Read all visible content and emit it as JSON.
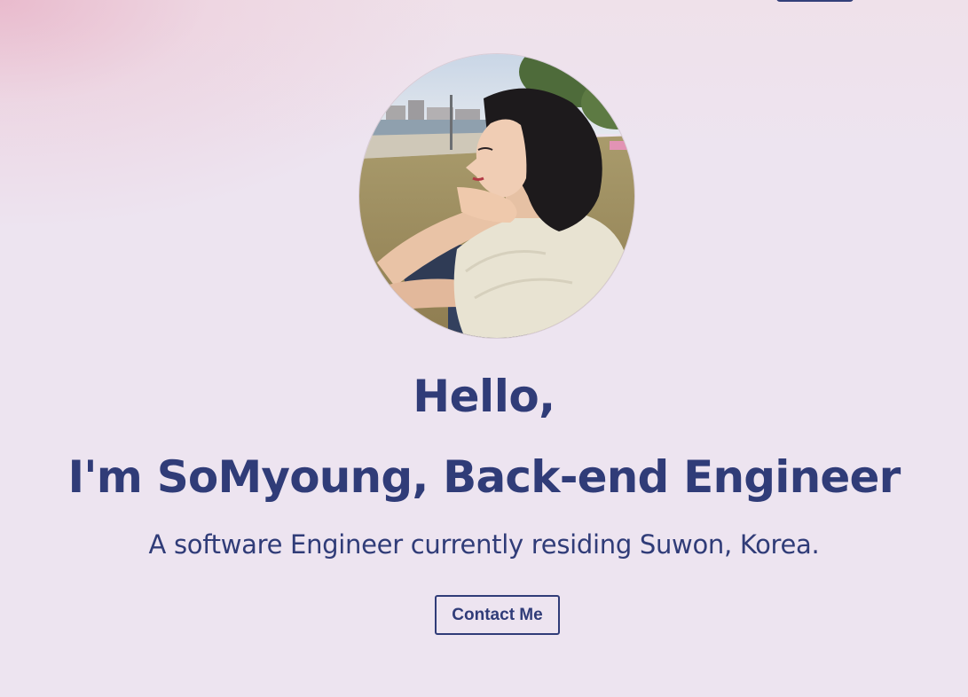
{
  "hero": {
    "greeting": "Hello,",
    "headline": "I'm SoMyoung, Back-end Engineer",
    "subtitle": "A software Engineer currently residing Suwon, Korea.",
    "contact_label": "Contact Me",
    "avatar_alt": "profile photo"
  },
  "theme": {
    "primary": "#303c78",
    "background": "#ede4f0",
    "glow": "#e8b4c8"
  }
}
